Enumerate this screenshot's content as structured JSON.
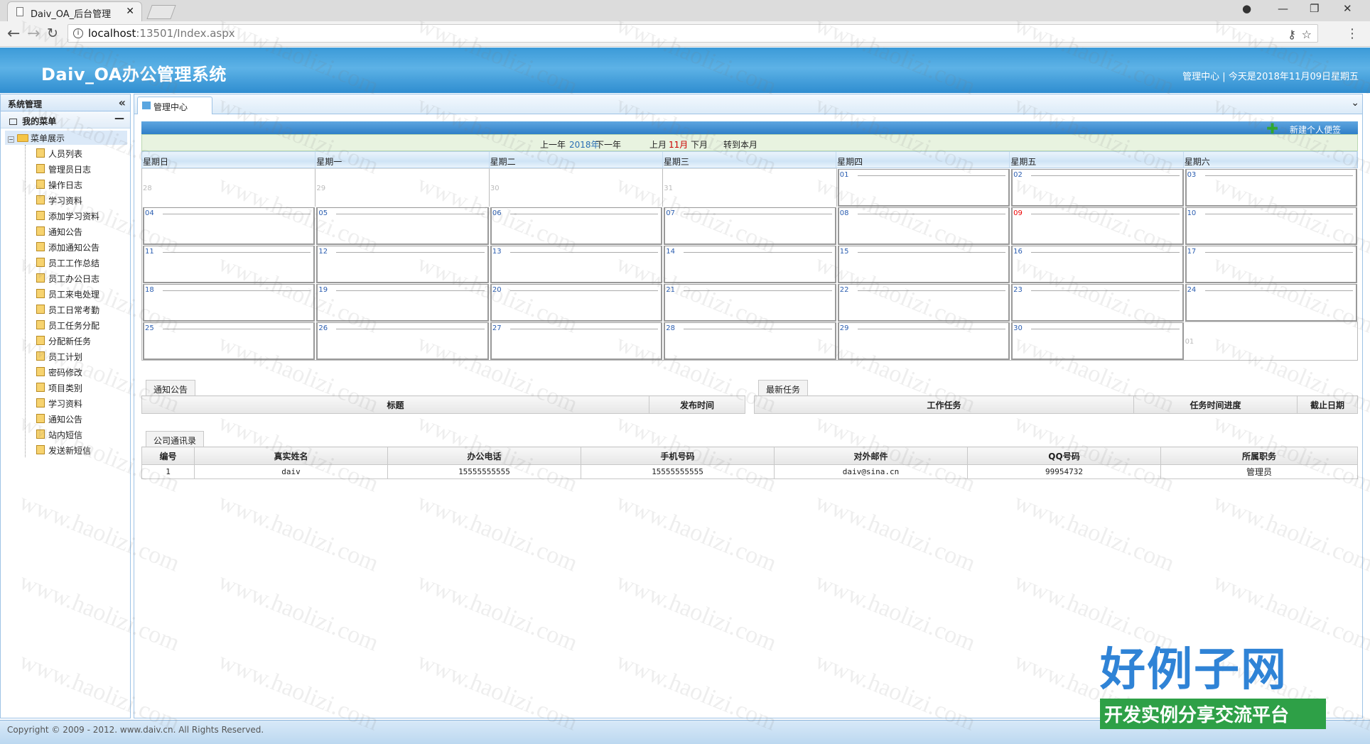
{
  "browser": {
    "tab_title": "Daiv_OA_后台管理",
    "url_host": "localhost",
    "url_path": ":13501/Index.aspx"
  },
  "header": {
    "title": "Daiv_OA办公管理系统",
    "right_text": "管理中心 | 今天是2018年11月09日星期五"
  },
  "sidebar": {
    "heading": "系统管理",
    "section": "我的菜单",
    "root": "菜单展示",
    "items": [
      "人员列表",
      "管理员日志",
      "操作日志",
      "学习资料",
      "添加学习资料",
      "通知公告",
      "添加通知公告",
      "员工工作总结",
      "员工办公日志",
      "员工来电处理",
      "员工日常考勤",
      "员工任务分配",
      "分配新任务",
      "员工计划",
      "密码修改",
      "项目类别",
      "学习资料",
      "通知公告",
      "站内短信",
      "发送新短信"
    ]
  },
  "main": {
    "tab_label": "管理中心",
    "new_note": "新建个人便签"
  },
  "calendar": {
    "prev_year": "上一年",
    "year": "2018年",
    "next_year": "下一年",
    "prev_month": "上月",
    "month": "11月",
    "next_month": "下月",
    "goto_current": "转到本月",
    "weekdays": [
      "星期日",
      "星期一",
      "星期二",
      "星期三",
      "星期四",
      "星期五",
      "星期六"
    ],
    "days": [
      "28",
      "29",
      "30",
      "31",
      "01",
      "02",
      "03",
      "04",
      "05",
      "06",
      "07",
      "08",
      "09",
      "10",
      "11",
      "12",
      "13",
      "14",
      "15",
      "16",
      "17",
      "18",
      "19",
      "20",
      "21",
      "22",
      "23",
      "24",
      "25",
      "26",
      "27",
      "28",
      "29",
      "30",
      "01"
    ],
    "today": "09"
  },
  "notice": {
    "tab": "通知公告",
    "columns": [
      "标题",
      "发布时间"
    ]
  },
  "tasks": {
    "tab": "最新任务",
    "columns": [
      "工作任务",
      "任务时间进度",
      "截止日期"
    ]
  },
  "contacts": {
    "tab": "公司通讯录",
    "columns": [
      "编号",
      "真实姓名",
      "办公电话",
      "手机号码",
      "对外邮件",
      "QQ号码",
      "所属职务"
    ],
    "rows": [
      [
        "1",
        "daiv",
        "15555555555",
        "15555555555",
        "daiv@sina.cn",
        "99954732",
        "管理员"
      ]
    ]
  },
  "footer": {
    "copyright": "Copyright © 2009 - 2012. www.daiv.cn. All Rights Reserved."
  },
  "watermark": {
    "text": "www.haolizi.com",
    "brand_big": "好例子网",
    "brand_small": "开发实例分享交流平台"
  }
}
